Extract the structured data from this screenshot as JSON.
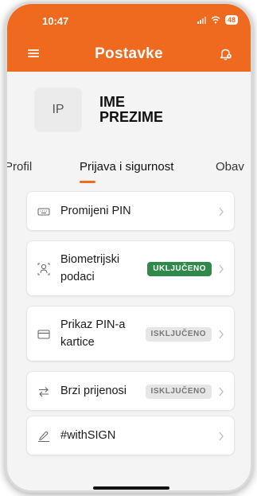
{
  "status_bar": {
    "time": "10:47",
    "battery": "48"
  },
  "header": {
    "title": "Postavke",
    "menu_icon": "hamburger-menu-icon",
    "notification_icon": "bell-icon"
  },
  "profile": {
    "initials": "IP",
    "name_line1": "IME",
    "name_line2": "PREZIME"
  },
  "tabs": [
    {
      "label": "Profil",
      "active": false
    },
    {
      "label": "Prijava i sigurnost",
      "active": true
    },
    {
      "label": "Obav",
      "active": false
    }
  ],
  "settings": [
    {
      "label": "Promijeni PIN",
      "icon": "keyboard-icon",
      "badge": null
    },
    {
      "label_line1": "Biometrijski",
      "label_line2": "podaci",
      "icon": "face-id-icon",
      "badge": "UKLJUČENO",
      "badge_state": "on"
    },
    {
      "label_line1": "Prikaz PIN-a",
      "label_line2": "kartice",
      "icon": "credit-card-icon",
      "badge": "ISKLJUČENO",
      "badge_state": "off"
    },
    {
      "label": "Brzi prijenosi",
      "icon": "transfer-arrows-icon",
      "badge": "ISKLJUČENO",
      "badge_state": "off"
    },
    {
      "label": "#withSIGN",
      "icon": "signature-icon",
      "badge": null
    }
  ],
  "colors": {
    "accent": "#ef6a1f",
    "badge_on": "#2f8a4a",
    "badge_off": "#e6e6e6"
  }
}
